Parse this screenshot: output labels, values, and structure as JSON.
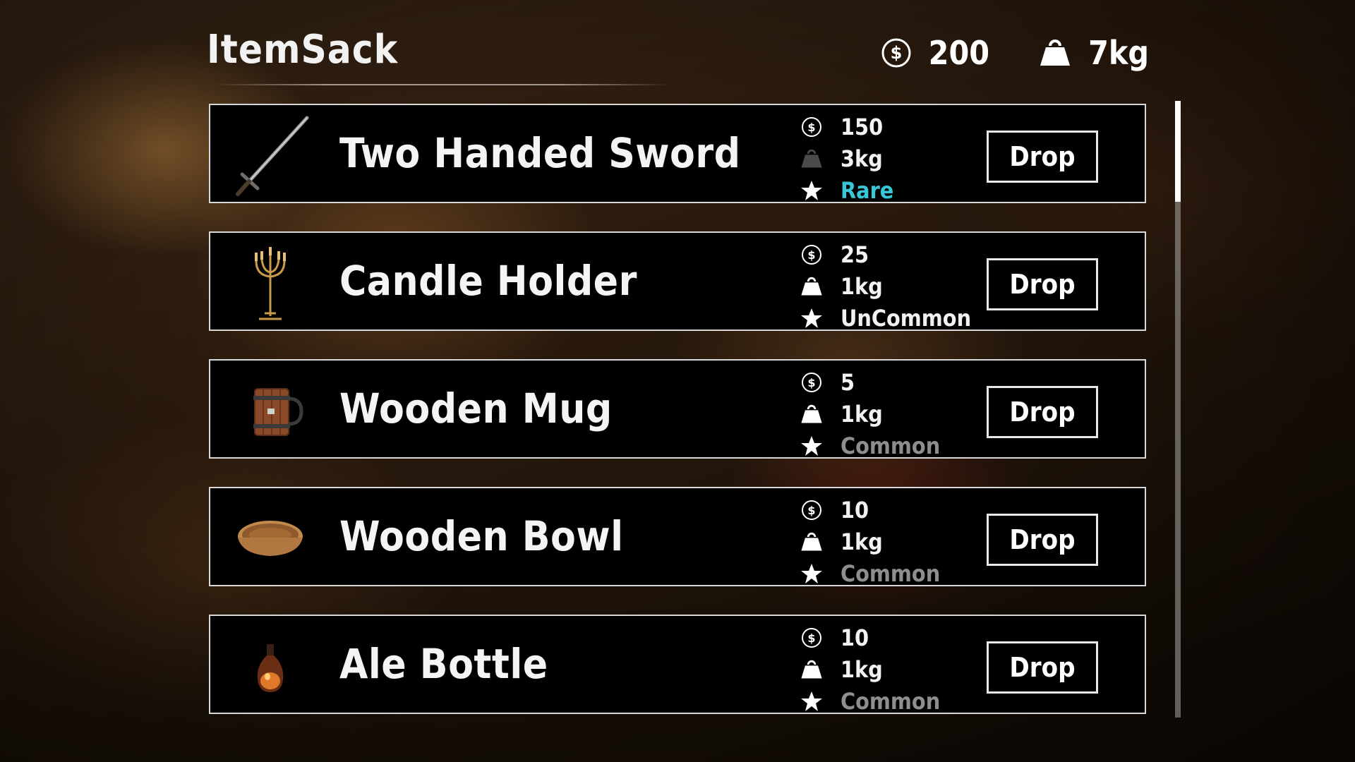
{
  "header": {
    "title": "ItemSack",
    "money": "200",
    "weight": "7kg",
    "money_icon": "dollar-coin-icon",
    "weight_icon": "weight-icon"
  },
  "items": [
    {
      "name": "Two Handed Sword",
      "icon": "sword-icon",
      "price": "150",
      "weight": "3kg",
      "rarity": "Rare",
      "drop_label": "Drop"
    },
    {
      "name": "Candle Holder",
      "icon": "candelabra-icon",
      "price": "25",
      "weight": "1kg",
      "rarity": "UnCommon",
      "drop_label": "Drop"
    },
    {
      "name": "Wooden Mug",
      "icon": "mug-icon",
      "price": "5",
      "weight": "1kg",
      "rarity": "Common",
      "drop_label": "Drop"
    },
    {
      "name": "Wooden Bowl",
      "icon": "bowl-icon",
      "price": "10",
      "weight": "1kg",
      "rarity": "Common",
      "drop_label": "Drop"
    },
    {
      "name": "Ale Bottle",
      "icon": "bottle-icon",
      "price": "10",
      "weight": "1kg",
      "rarity": "Common",
      "drop_label": "Drop"
    }
  ],
  "colors": {
    "rare": "#38c6d8",
    "uncommon": "#f2f2f2",
    "common": "#8e8e8e"
  }
}
